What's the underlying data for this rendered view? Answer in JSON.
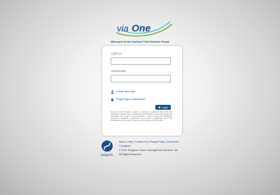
{
  "brand": {
    "logo_text_left": "via",
    "logo_text_right": "One",
    "welcome": "Welcome to the viaOne® Self-Service Portal"
  },
  "login_form": {
    "user_id_label": "USER ID",
    "user_id_value": "",
    "password_label": "PASSWORD",
    "password_value": "",
    "create_user_label": "Create New User",
    "forgot_label": "Forgot login or password?",
    "login_button": "Login",
    "notice": "Access to this information resource is restricted to authorized users only. This information resource may be monitored for administrative and security reasons. By proceeding, you consent to this monitoring. In order to protect the information entrusted to Sedgwick, unauthorized access and/or unauthorized use of this information resource may be prosecuted to the fullest extent of the law."
  },
  "footer": {
    "company": "sedgwick.",
    "links": [
      "About",
      "Help",
      "Contact Us",
      "Privacy Policy",
      "Terms and Conditions"
    ],
    "copyright": "© 2022 Sedgwick Claims Management Services, Inc.",
    "rights": "All Rights Reserved."
  },
  "colors": {
    "brand_blue": "#1b4f89",
    "logo_green": "#7ab648",
    "accent_cyan": "#2fa6e0"
  }
}
